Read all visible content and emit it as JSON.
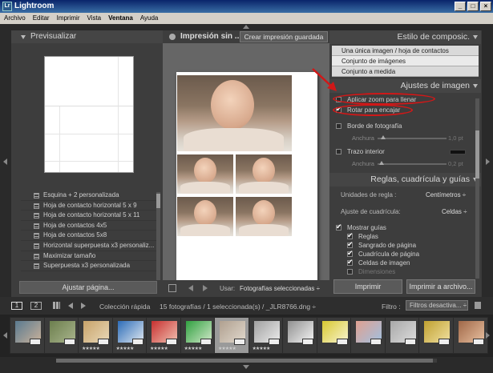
{
  "window": {
    "title": "Lightroom",
    "app_icon": "Lr",
    "buttons": [
      "_",
      "□",
      "×"
    ]
  },
  "menu": [
    "Archivo",
    "Editar",
    "Imprimir",
    "Vista",
    "Ventana",
    "Ayuda"
  ],
  "left_panel": {
    "header": "Previsualizar",
    "presets": [
      "Esquina + 2 personalizada",
      "Hoja de contacto horizontal 5 x 9",
      "Hoja de contacto horizontal 5 x 11",
      "Hoja de contactos 4x5",
      "Hoja de contactos 5x8",
      "Horizontal superpuesta x3 personaliz...",
      "Maximizar tamaño",
      "Superpuesta x3 personalizada"
    ],
    "fit_button": "Ajustar página..."
  },
  "center": {
    "title": "Impresión sin ...",
    "save_button": "Crear impresión guardada",
    "use_label": "Usar:",
    "use_value": "Fotografías seleccionadas ÷"
  },
  "right_panel": {
    "layout_style_header": "Estilo de composic.",
    "layout_options": [
      "Una única imagen / hoja de contactos",
      "Conjunto de imágenes",
      "Conjunto a medida"
    ],
    "layout_selected_index": 1,
    "image_settings_header": "Ajustes de imagen",
    "zoom_to_fill": "Aplicar zoom para llenar",
    "zoom_to_fill_checked": false,
    "rotate_to_fit": "Rotar para encajar",
    "rotate_to_fit_checked": true,
    "photo_border": "Borde de fotografía",
    "photo_border_width_label": "Anchura",
    "photo_border_width_value": "1,0 pt",
    "inner_stroke": "Trazo interior",
    "inner_stroke_width_label": "Anchura",
    "inner_stroke_width_value": "0,2 pt",
    "rulers_header": "Reglas, cuadrícula y guías",
    "ruler_units_label": "Unidades de regla :",
    "ruler_units_value": "Centímetros ÷",
    "grid_snap_label": "Ajuste de cuadrícula:",
    "grid_snap_value": "Celdas ÷",
    "show_guides": "Mostrar guías",
    "guides": [
      "Reglas",
      "Sangrado de página",
      "Cuadrícula de página",
      "Celdas de imagen",
      "Dimensiones"
    ],
    "print_button": "Imprimir",
    "print_to_file_button": "Imprimir a archivo..."
  },
  "filmstrip_bar": {
    "page1": "1",
    "page2": "2",
    "collection": "Colección rápida",
    "count_text": "15 fotografías / 1 seleccionada(s) / _JLR8766.dng ÷",
    "filter_label": "Filtro :",
    "filter_value": "Filtros desactiva... ÷"
  },
  "filmstrip": {
    "selected_index": 6,
    "stars": "★★★★★",
    "thumbs": [
      {
        "c1": "#5a7a90",
        "c2": "#c9b19a"
      },
      {
        "c1": "#6c7f4e",
        "c2": "#a9b48c"
      },
      {
        "c1": "#c8a36a",
        "c2": "#e8d8b8"
      },
      {
        "c1": "#2c6cb8",
        "c2": "#e0e8f0"
      },
      {
        "c1": "#c83030",
        "c2": "#f0c0b0"
      },
      {
        "c1": "#30a040",
        "c2": "#d0e8c8"
      },
      {
        "c1": "#b0a090",
        "c2": "#e0d8cc"
      },
      {
        "c1": "#a0a0a0",
        "c2": "#ececec"
      },
      {
        "c1": "#909090",
        "c2": "#f4f4f4"
      },
      {
        "c1": "#d8c830",
        "c2": "#f8f4d0"
      },
      {
        "c1": "#e0a090",
        "c2": "#a0c0e0"
      },
      {
        "c1": "#a8a8a8",
        "c2": "#dcdcdc"
      },
      {
        "c1": "#c0a030",
        "c2": "#f0e0a0"
      },
      {
        "c1": "#a06848",
        "c2": "#e8c0a0"
      }
    ],
    "thumbs_with_stars": [
      2,
      3,
      4,
      5,
      6,
      7
    ]
  },
  "colors": {
    "highlight_red": "#d01818",
    "panel": "#3d3d3d",
    "canvas": "#666666"
  }
}
